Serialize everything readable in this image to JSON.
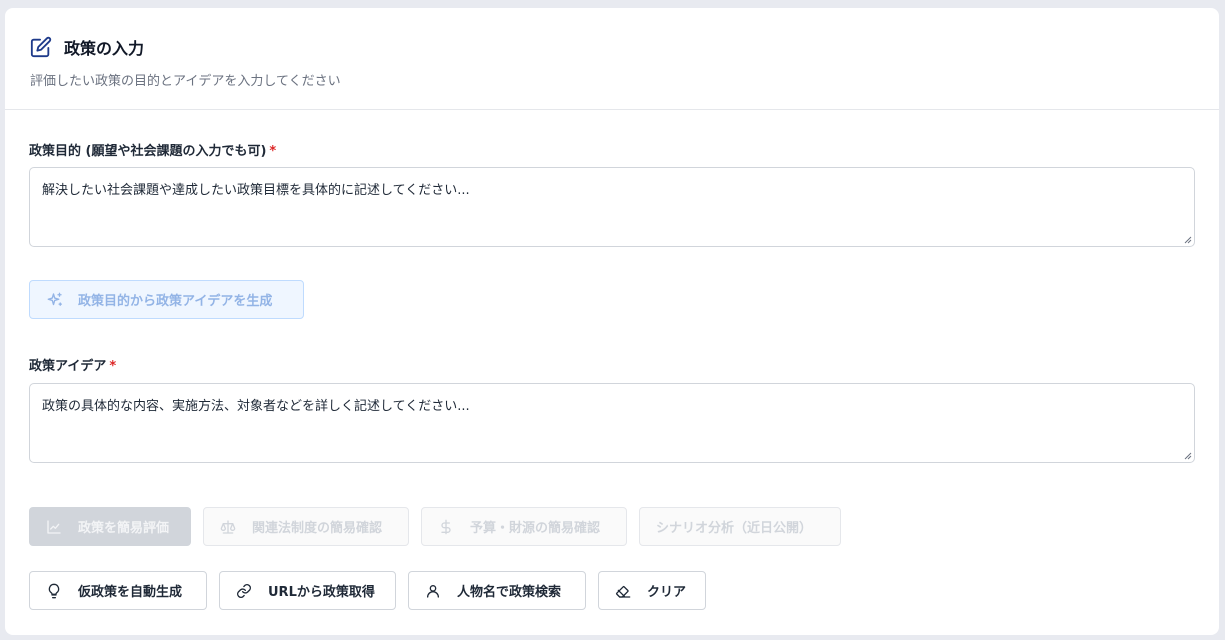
{
  "header": {
    "title": "政策の入力",
    "subtitle": "評価したい政策の目的とアイデアを入力してください",
    "icon": "edit-icon"
  },
  "purpose": {
    "label": "政策目的 (願望や社会課題の入力でも可)",
    "required_mark": "*",
    "placeholder": "解決したい社会課題や達成したい政策目標を具体的に記述してください..."
  },
  "generate_idea_button": {
    "label": "政策目的から政策アイデアを生成",
    "icon": "sparkles-icon"
  },
  "idea": {
    "label": "政策アイデア",
    "required_mark": "*",
    "placeholder": "政策の具体的な内容、実施方法、対象者などを詳しく記述してください..."
  },
  "action_buttons": [
    {
      "label": "政策を簡易評価",
      "icon": "chart-line-icon"
    },
    {
      "label": "関連法制度の簡易確認",
      "icon": "scale-icon"
    },
    {
      "label": "予算・財源の簡易確認",
      "icon": "dollar-icon"
    },
    {
      "label": "シナリオ分析（近日公開）",
      "icon": ""
    }
  ],
  "tool_buttons": [
    {
      "label": "仮政策を自動生成",
      "icon": "lightbulb-icon"
    },
    {
      "label": "URLから政策取得",
      "icon": "link-icon"
    },
    {
      "label": "人物名で政策検索",
      "icon": "user-icon"
    },
    {
      "label": "クリア",
      "icon": "eraser-icon"
    }
  ],
  "colors": {
    "accent": "#1e3a8a",
    "required": "#dc2626",
    "disabled_primary": "#d1d5db"
  }
}
